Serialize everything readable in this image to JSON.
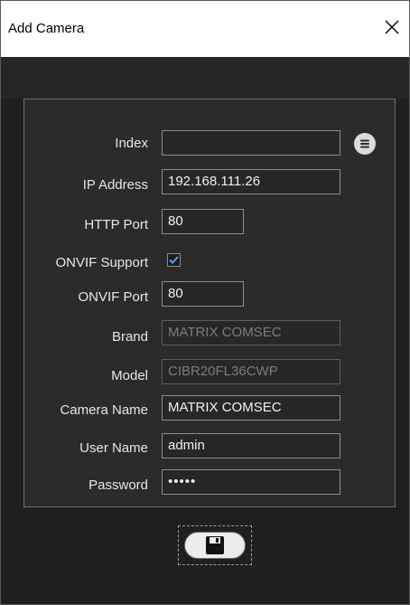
{
  "window": {
    "title": "Add Camera"
  },
  "form": {
    "index": {
      "label": "Index",
      "value": ""
    },
    "ip_address": {
      "label": "IP Address",
      "value": "192.168.111.26"
    },
    "http_port": {
      "label": "HTTP Port",
      "value": "80"
    },
    "onvif_support": {
      "label": "ONVIF Support",
      "checked": true
    },
    "onvif_port": {
      "label": "ONVIF Port",
      "value": "80"
    },
    "brand": {
      "label": "Brand",
      "value": "MATRIX COMSEC"
    },
    "model": {
      "label": "Model",
      "value": "CIBR20FL36CWP"
    },
    "camera_name": {
      "label": "Camera Name",
      "value": "MATRIX COMSEC"
    },
    "user_name": {
      "label": "User Name",
      "value": "admin"
    },
    "password": {
      "label": "Password",
      "value": "•••••"
    }
  },
  "icons": {
    "close": "close-icon",
    "list": "list-icon",
    "checkmark": "checkmark-icon",
    "save": "floppy-disk-icon"
  },
  "colors": {
    "background": "#1f1f1f",
    "panel": "#2b2b2b",
    "accent_check": "#4aa3ff"
  }
}
